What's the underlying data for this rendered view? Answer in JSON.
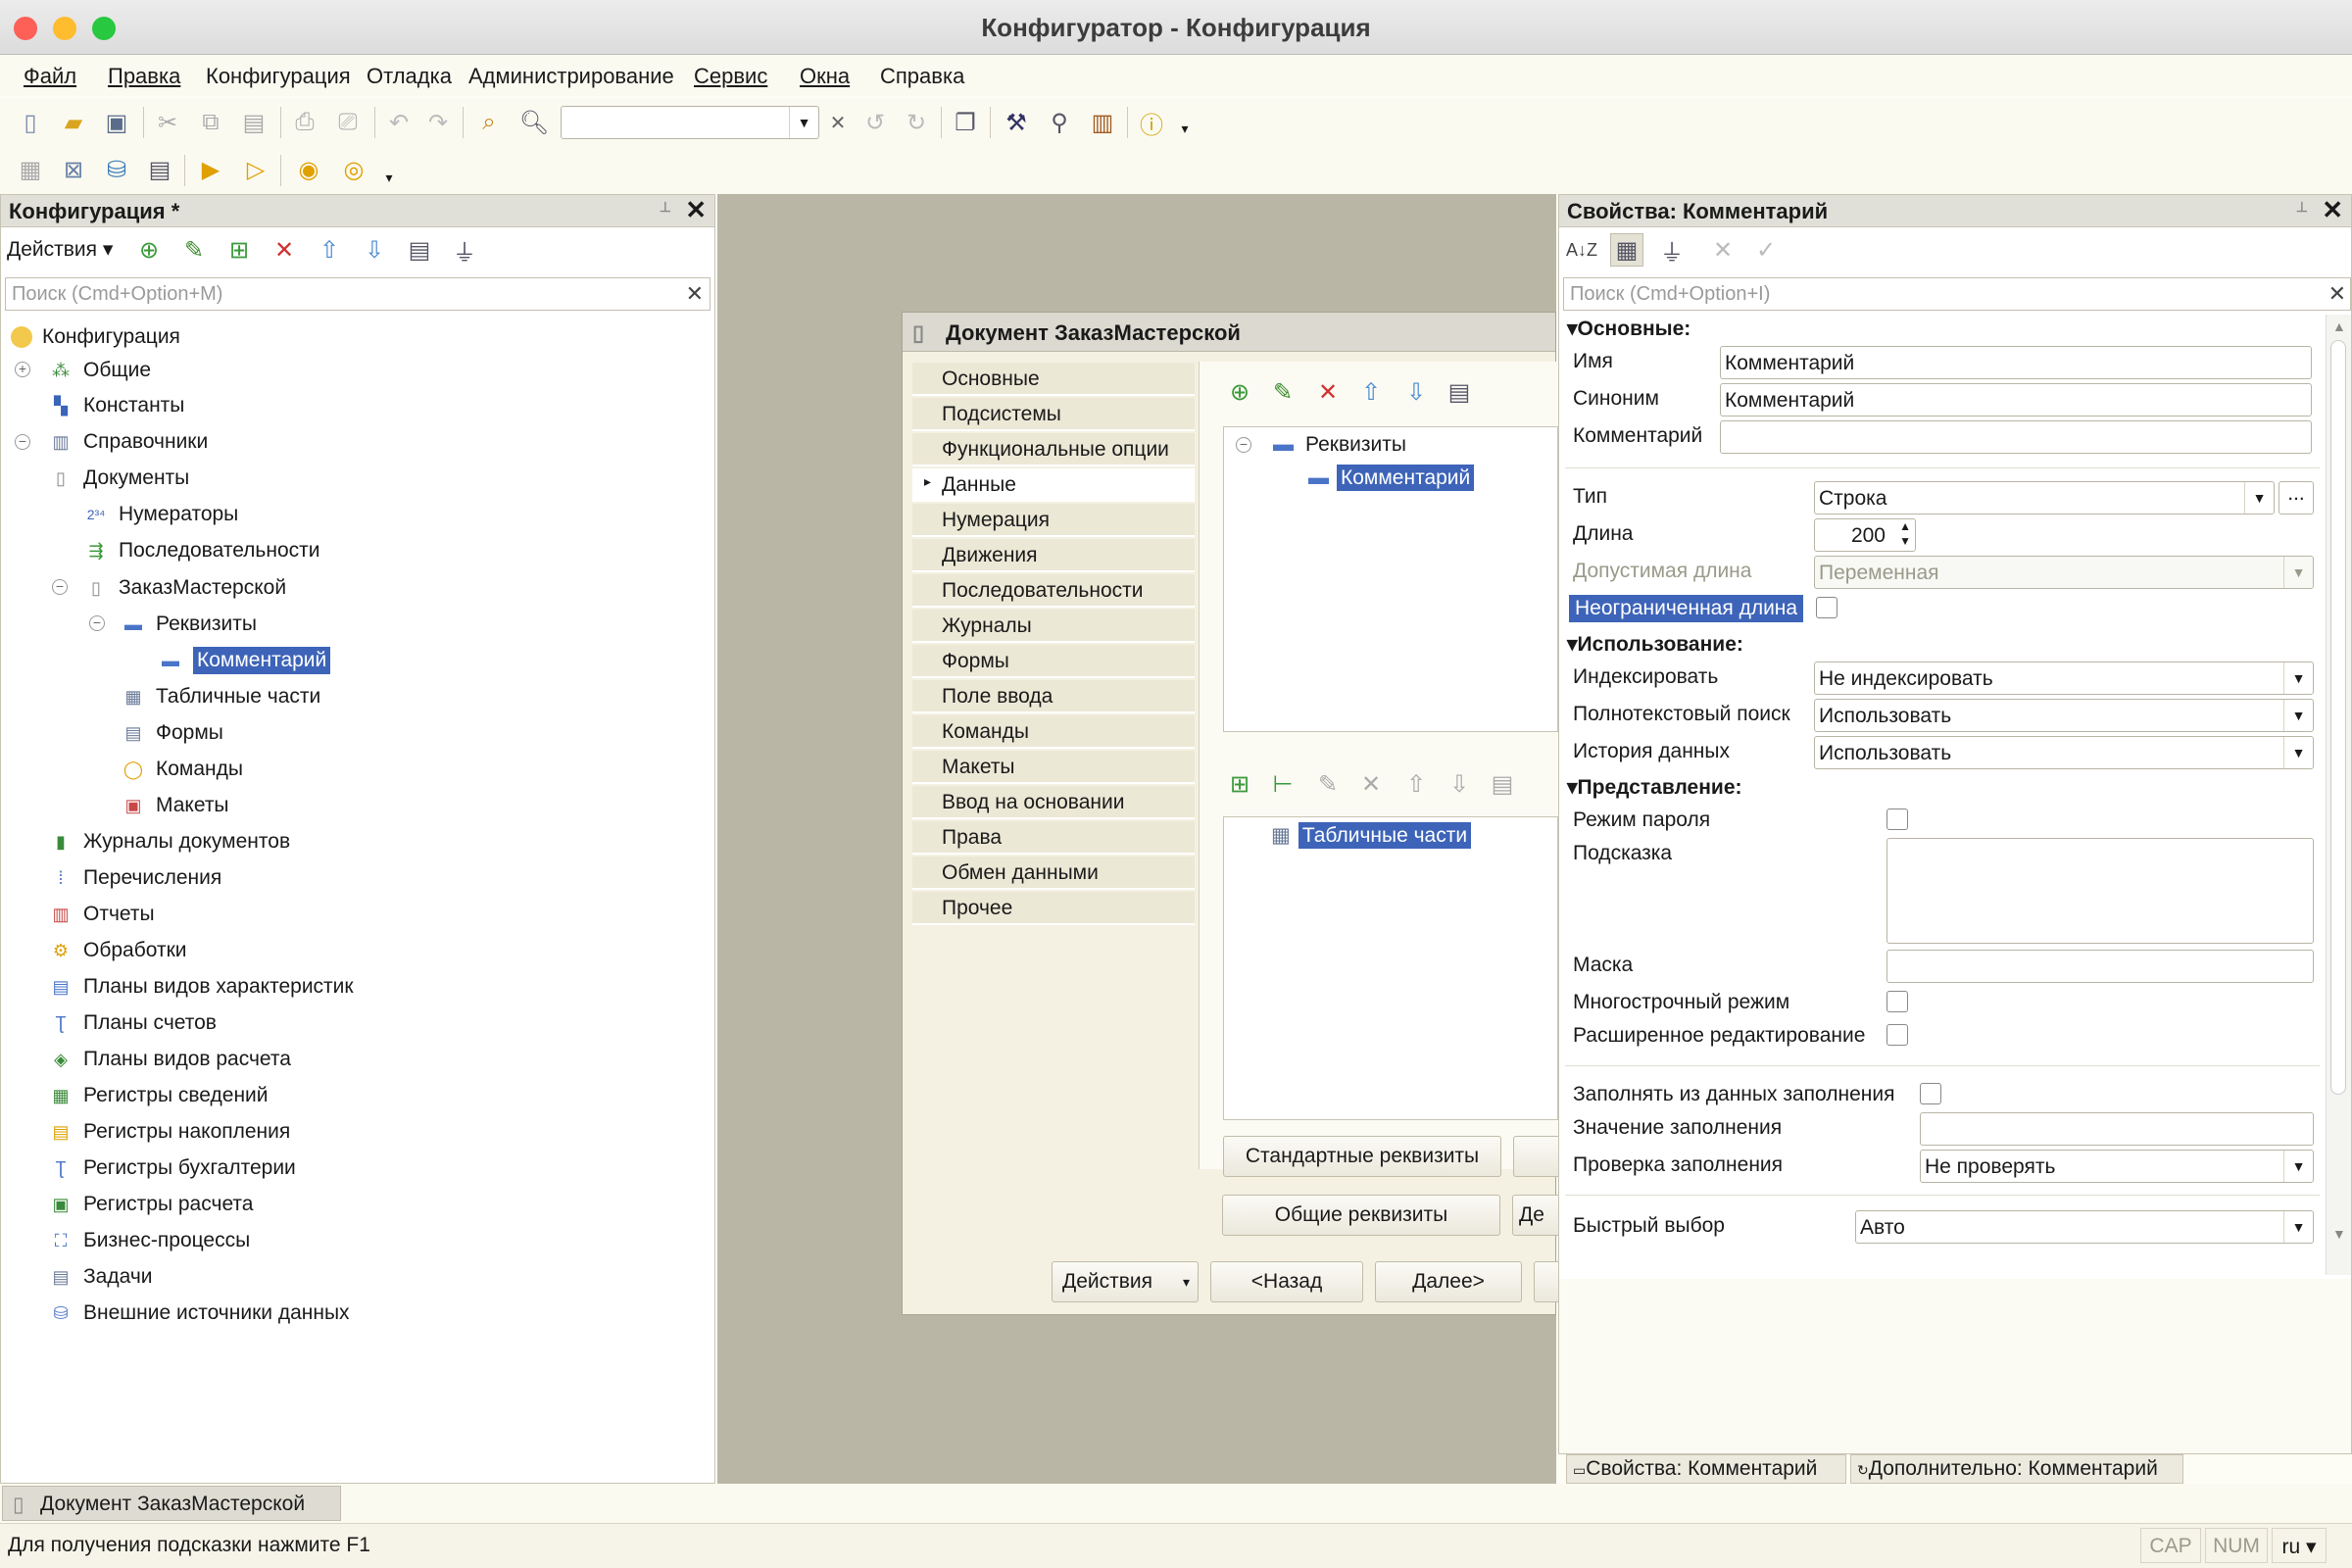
{
  "window": {
    "title": "Конфигуратор - Конфигурация"
  },
  "menu": [
    "Файл",
    "Правка",
    "Конфигурация",
    "Отладка",
    "Администрирование",
    "Сервис",
    "Окна",
    "Справка"
  ],
  "left_panel": {
    "title": "Конфигурация *",
    "actions_label": "Действия",
    "search_placeholder": "Поиск (Cmd+Option+M)",
    "tree": [
      {
        "label": "Конфигурация",
        "icon": "config-icon"
      },
      {
        "label": "Общие",
        "icon": "common-icon"
      },
      {
        "label": "Константы",
        "icon": "constants-icon"
      },
      {
        "label": "Справочники",
        "icon": "catalogs-icon"
      },
      {
        "label": "Документы",
        "icon": "documents-icon"
      },
      {
        "label": "Нумераторы",
        "icon": "numerators-icon"
      },
      {
        "label": "Последовательности",
        "icon": "sequences-icon"
      },
      {
        "label": "ЗаказМастерской",
        "icon": "document-icon"
      },
      {
        "label": "Реквизиты",
        "icon": "attributes-icon"
      },
      {
        "label": "Комментарий",
        "icon": "attribute-icon"
      },
      {
        "label": "Табличные части",
        "icon": "tabular-icon"
      },
      {
        "label": "Формы",
        "icon": "forms-icon"
      },
      {
        "label": "Команды",
        "icon": "commands-icon"
      },
      {
        "label": "Макеты",
        "icon": "templates-icon"
      },
      {
        "label": "Журналы документов",
        "icon": "journals-icon"
      },
      {
        "label": "Перечисления",
        "icon": "enums-icon"
      },
      {
        "label": "Отчеты",
        "icon": "reports-icon"
      },
      {
        "label": "Обработки",
        "icon": "dataprocessors-icon"
      },
      {
        "label": "Планы видов характеристик",
        "icon": "chart-of-characteristics-icon"
      },
      {
        "label": "Планы счетов",
        "icon": "chart-of-accounts-icon"
      },
      {
        "label": "Планы видов расчета",
        "icon": "chart-of-calc-icon"
      },
      {
        "label": "Регистры сведений",
        "icon": "info-registers-icon"
      },
      {
        "label": "Регистры накопления",
        "icon": "accum-registers-icon"
      },
      {
        "label": "Регистры бухгалтерии",
        "icon": "accounting-registers-icon"
      },
      {
        "label": "Регистры расчета",
        "icon": "calc-registers-icon"
      },
      {
        "label": "Бизнес-процессы",
        "icon": "business-process-icon"
      },
      {
        "label": "Задачи",
        "icon": "tasks-icon"
      },
      {
        "label": "Внешние источники данных",
        "icon": "external-sources-icon"
      }
    ]
  },
  "doc_window": {
    "title": "Документ ЗаказМастерской",
    "tabs": [
      "Основные",
      "Подсистемы",
      "Функциональные опции",
      "Данные",
      "Нумерация",
      "Движения",
      "Последовательности",
      "Журналы",
      "Формы",
      "Поле ввода",
      "Команды",
      "Макеты",
      "Ввод на основании",
      "Права",
      "Обмен данными",
      "Прочее"
    ],
    "attr_root": "Реквизиты",
    "attr_item": "Комментарий",
    "tabular_item": "Табличные части",
    "btn_standard": "Стандартные реквизиты",
    "btn_common": "Общие реквизиты",
    "btn_common_right": "Де",
    "btn_actions": "Действия",
    "btn_back": "<Назад",
    "btn_next": "Далее>"
  },
  "props": {
    "title": "Свойства: Комментарий",
    "search_placeholder": "Поиск (Cmd+Option+I)",
    "sec_main": "Основные:",
    "name_label": "Имя",
    "name_value": "Комментарий",
    "synonym_label": "Синоним",
    "synonym_value": "Комментарий",
    "comment_label": "Комментарий",
    "comment_value": "",
    "type_label": "Тип",
    "type_value": "Строка",
    "length_label": "Длина",
    "length_value": "200",
    "allowed_length_label": "Допустимая длина",
    "allowed_length_value": "Переменная",
    "unlimited_label": "Неограниченная длина",
    "sec_usage": "Использование:",
    "index_label": "Индексировать",
    "index_value": "Не индексировать",
    "fulltext_label": "Полнотекстовый поиск",
    "fulltext_value": "Использовать",
    "history_label": "История данных",
    "history_value": "Использовать",
    "sec_presentation": "Представление:",
    "password_label": "Режим пароля",
    "tooltip_label": "Подсказка",
    "mask_label": "Маска",
    "multiline_label": "Многострочный режим",
    "extended_label": "Расширенное редактирование",
    "fill_from_label": "Заполнять из данных заполнения",
    "fill_value_label": "Значение заполнения",
    "fill_check_label": "Проверка заполнения",
    "fill_check_value": "Не проверять",
    "quick_choice_label": "Быстрый выбор",
    "quick_choice_value": "Авто",
    "tab_props": "Свойства: Комментарий",
    "tab_extra": "Дополнительно: Комментарий"
  },
  "taskbar": {
    "item": "Документ ЗаказМастерской"
  },
  "status": {
    "hint": "Для получения подсказки нажмите F1",
    "cap": "CAP",
    "num": "NUM",
    "lang": "ru"
  }
}
